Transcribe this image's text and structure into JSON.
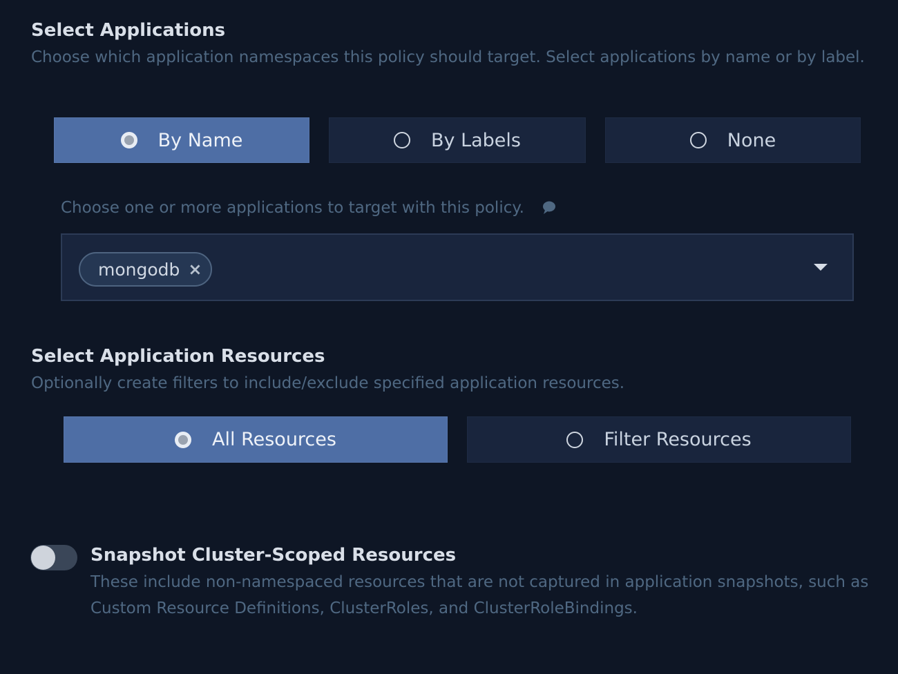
{
  "applications": {
    "title": "Select Applications",
    "description": "Choose which application namespaces this policy should target. Select applications by name or by label.",
    "options": [
      {
        "label": "By Name",
        "selected": true
      },
      {
        "label": "By Labels",
        "selected": false
      },
      {
        "label": "None",
        "selected": false
      }
    ],
    "hint": "Choose one or more applications to target with this policy.",
    "hint_icon": "speech-bubble-icon",
    "selected_chips": [
      "mongodb"
    ],
    "chip_remove_glyph": "×",
    "dropdown_icon": "caret-down-icon"
  },
  "resources": {
    "title": "Select Application Resources",
    "description": "Optionally create filters to include/exclude specified application resources.",
    "options": [
      {
        "label": "All Resources",
        "selected": true
      },
      {
        "label": "Filter Resources",
        "selected": false
      }
    ]
  },
  "cluster_scoped": {
    "title": "Snapshot Cluster-Scoped Resources",
    "description": "These include non-namespaced resources that are not captured in application snapshots, such as Custom Resource Definitions, ClusterRoles, and ClusterRoleBindings.",
    "toggle_on": false
  },
  "colors": {
    "background": "#0e1625",
    "option_bg": "#19253d",
    "option_selected_bg": "#4e6ea5",
    "muted_text": "#4f6882"
  }
}
